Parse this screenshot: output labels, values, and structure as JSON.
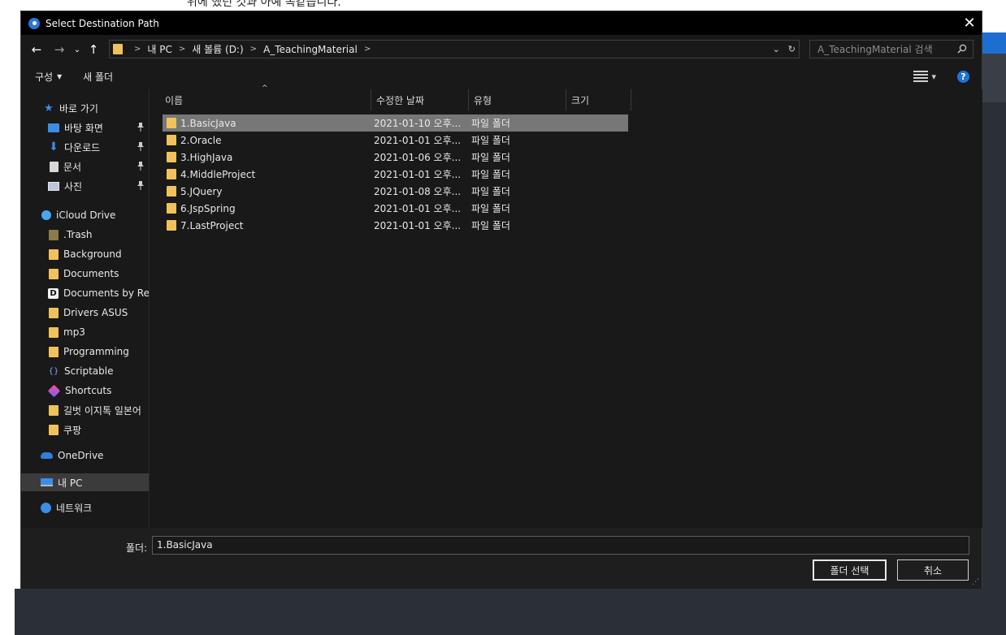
{
  "background": {
    "caption": "위에 했던 것과 아예 똑같습니다."
  },
  "dialog": {
    "title": "Select Destination Path",
    "close_glyph": "✕"
  },
  "nav": {
    "back_glyph": "←",
    "forward_glyph": "→",
    "history_glyph": "⌄",
    "up_glyph": "↑"
  },
  "address": {
    "crumbs": [
      "내 PC",
      "새 볼륨 (D:)",
      "A_TeachingMaterial"
    ],
    "separator": ">",
    "dropdown_glyph": "⌄",
    "refresh_glyph": "↻"
  },
  "search": {
    "placeholder": "A_TeachingMaterial 검색"
  },
  "toolbar": {
    "organize_label": "구성",
    "organize_arrow": "▾",
    "new_folder_label": "새 폴더",
    "view_arrow": "▾",
    "help_glyph": "?"
  },
  "sidebar": {
    "items": [
      {
        "label": "바로 가기",
        "icon": "quick-access-star-icon"
      },
      {
        "label": "바탕 화면",
        "icon": "desktop-icon",
        "pinned": true
      },
      {
        "label": "다운로드",
        "icon": "download-icon",
        "pinned": true
      },
      {
        "label": "문서",
        "icon": "documents-icon",
        "pinned": true
      },
      {
        "label": "사진",
        "icon": "pictures-icon",
        "pinned": true
      },
      {
        "label": "iCloud Drive",
        "icon": "icloud-icon"
      },
      {
        "label": ".Trash",
        "icon": "folder-icon"
      },
      {
        "label": "Background",
        "icon": "folder-icon"
      },
      {
        "label": "Documents",
        "icon": "folder-icon"
      },
      {
        "label": "Documents by Rea",
        "icon": "documents-by-readdle-icon"
      },
      {
        "label": "Drivers ASUS",
        "icon": "folder-icon"
      },
      {
        "label": "mp3",
        "icon": "folder-icon"
      },
      {
        "label": "Programming",
        "icon": "folder-icon"
      },
      {
        "label": "Scriptable",
        "icon": "scriptable-icon"
      },
      {
        "label": "Shortcuts",
        "icon": "shortcuts-icon"
      },
      {
        "label": "길벗 이지톡 일본어",
        "icon": "folder-icon"
      },
      {
        "label": "쿠팡",
        "icon": "folder-icon"
      },
      {
        "label": "OneDrive",
        "icon": "onedrive-icon"
      },
      {
        "label": "내 PC",
        "icon": "this-pc-icon",
        "selected": true
      },
      {
        "label": "네트워크",
        "icon": "network-icon"
      }
    ]
  },
  "columns": {
    "name": "이름",
    "date": "수정한 날짜",
    "type": "유형",
    "size": "크기",
    "sort_glyph": "^"
  },
  "files": [
    {
      "name": "1.BasicJava",
      "date": "2021-01-10 오후...",
      "type": "파일 폴더",
      "selected": true
    },
    {
      "name": "2.Oracle",
      "date": "2021-01-01 오후...",
      "type": "파일 폴더"
    },
    {
      "name": "3.HighJava",
      "date": "2021-01-06 오후...",
      "type": "파일 폴더"
    },
    {
      "name": "4.MiddleProject",
      "date": "2021-01-01 오후...",
      "type": "파일 폴더"
    },
    {
      "name": "5.JQuery",
      "date": "2021-01-08 오후...",
      "type": "파일 폴더"
    },
    {
      "name": "6.JspSpring",
      "date": "2021-01-01 오후...",
      "type": "파일 폴더"
    },
    {
      "name": "7.LastProject",
      "date": "2021-01-01 오후...",
      "type": "파일 폴더"
    }
  ],
  "footer": {
    "folder_label": "폴더:",
    "folder_value": "1.BasicJava",
    "ok_label": "폴더 선택",
    "cancel_label": "취소"
  },
  "colors": {
    "dialog_bg": "#191919",
    "selection": "#777777",
    "folder": "#f1c25b",
    "accent": "#1d74d8"
  }
}
